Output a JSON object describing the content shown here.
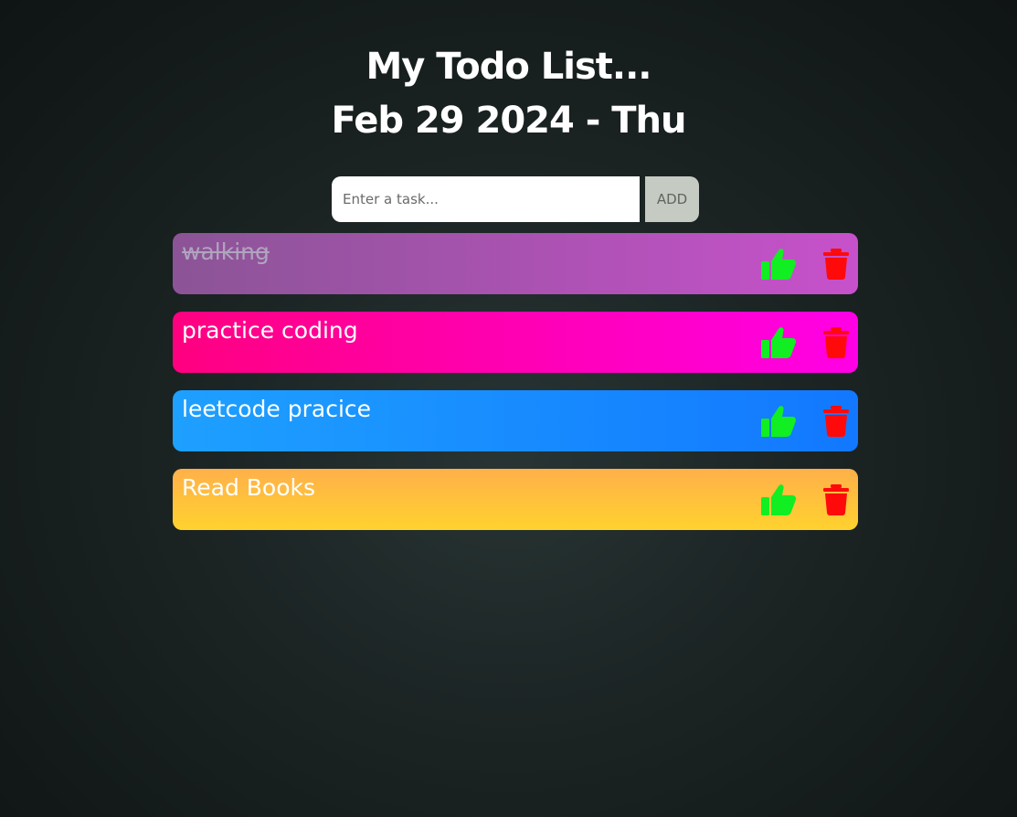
{
  "header": {
    "title": "My Todo List...",
    "date": "Feb 29 2024 - Thu"
  },
  "input": {
    "placeholder": "Enter a task...",
    "value": "",
    "add_label": "ADD"
  },
  "tasks": [
    {
      "text": "walking",
      "completed": true,
      "gradient": [
        "#8b5496",
        "#c751cb"
      ]
    },
    {
      "text": "practice coding",
      "completed": false,
      "gradient": [
        "#ff0080",
        "#ff00e6"
      ]
    },
    {
      "text": "leetcode pracice",
      "completed": false,
      "gradient": [
        "#1ea0ff",
        "#1278ff"
      ]
    },
    {
      "text": "Read Books",
      "completed": false,
      "gradient": [
        "#ffb04a",
        "#ffd22e"
      ]
    }
  ],
  "icons": {
    "like": "thumbs-up-icon",
    "delete": "trash-icon",
    "like_color": "#11ee22",
    "delete_color": "#ff0a0a"
  }
}
